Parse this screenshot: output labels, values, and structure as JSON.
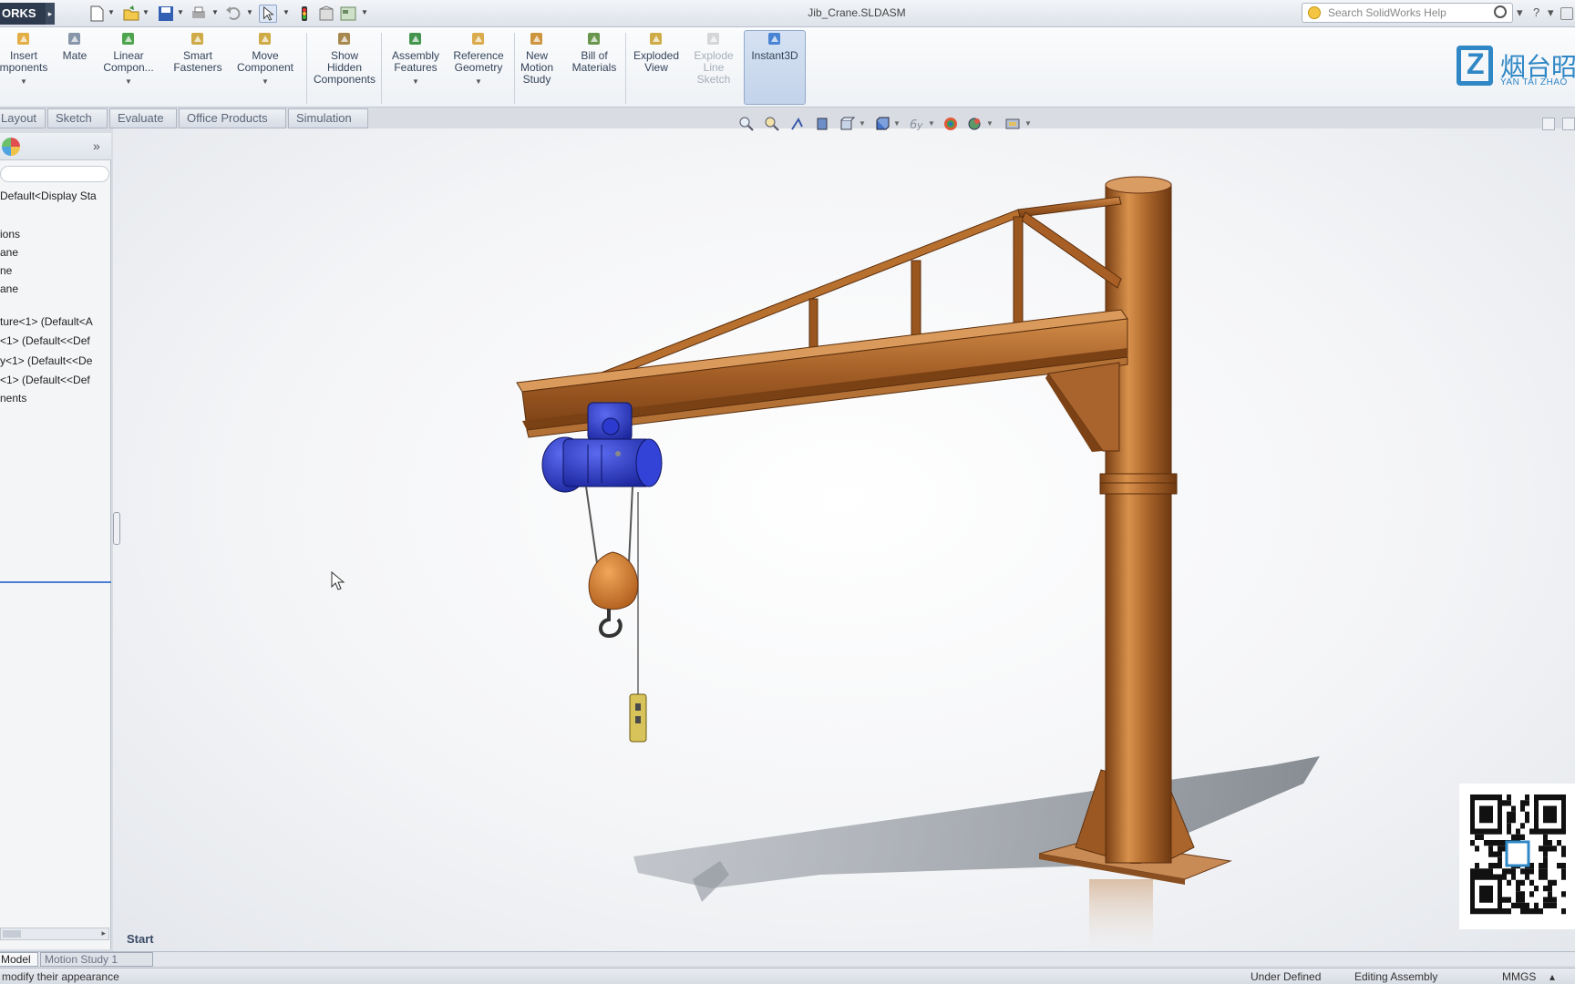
{
  "window": {
    "brand": "ORKS",
    "document_title": "Jib_Crane.SLDASM",
    "help_search_placeholder": "Search SolidWorks Help"
  },
  "ribbon": {
    "commands": [
      {
        "id": "insert-components",
        "label": "Insert\nmponents",
        "icon": "insert-components-icon",
        "dropdown": true
      },
      {
        "id": "mate",
        "label": "Mate",
        "icon": "mate-icon",
        "dropdown": false
      },
      {
        "id": "linear-component-pattern",
        "label": "Linear\nCompon...",
        "icon": "linear-pattern-icon",
        "dropdown": true
      },
      {
        "id": "smart-fasteners",
        "label": "Smart\nFasteners",
        "icon": "smart-fasteners-icon",
        "dropdown": false
      },
      {
        "id": "move-component",
        "label": "Move\nComponent",
        "icon": "move-component-icon",
        "dropdown": true
      },
      {
        "id": "show-hidden-components",
        "label": "Show\nHidden\nComponents",
        "icon": "show-hidden-icon",
        "dropdown": false
      },
      {
        "id": "assembly-features",
        "label": "Assembly\nFeatures",
        "icon": "assembly-features-icon",
        "dropdown": true
      },
      {
        "id": "reference-geometry",
        "label": "Reference\nGeometry",
        "icon": "reference-geometry-icon",
        "dropdown": true
      },
      {
        "id": "new-motion-study",
        "label": "New\nMotion\nStudy",
        "icon": "motion-study-icon",
        "dropdown": false
      },
      {
        "id": "bill-of-materials",
        "label": "Bill of\nMaterials",
        "icon": "bom-icon",
        "dropdown": false
      },
      {
        "id": "exploded-view",
        "label": "Exploded\nView",
        "icon": "exploded-view-icon",
        "dropdown": false
      },
      {
        "id": "explode-line-sketch",
        "label": "Explode\nLine\nSketch",
        "icon": "explode-line-icon",
        "dropdown": false,
        "disabled": true
      },
      {
        "id": "instant3d",
        "label": "Instant3D",
        "icon": "instant3d-icon",
        "dropdown": false,
        "active": true
      }
    ]
  },
  "logo": {
    "cn": "烟台昭",
    "en": "YAN TAI ZHAO"
  },
  "tabs": [
    "Layout",
    "Sketch",
    "Evaluate",
    "Office Products",
    "Simulation"
  ],
  "feature_tree": {
    "items": [
      "Default<Display Sta",
      "ions",
      "ane",
      "ne",
      "ane",
      "ture<1> (Default<A",
      "<1> (Default<<Def",
      "y<1> (Default<<De",
      "<1> (Default<<Def",
      "nents"
    ]
  },
  "viewport": {
    "start_label": "Start"
  },
  "bottom_tabs": [
    "Model",
    "Motion Study 1"
  ],
  "status": {
    "hint": "modify their appearance",
    "state": "Under Defined",
    "mode": "Editing Assembly",
    "units": "MMGS"
  },
  "colors": {
    "crane": "#b06a2e",
    "hoist": "#2f3fc9",
    "accent": "#2f87c5"
  }
}
